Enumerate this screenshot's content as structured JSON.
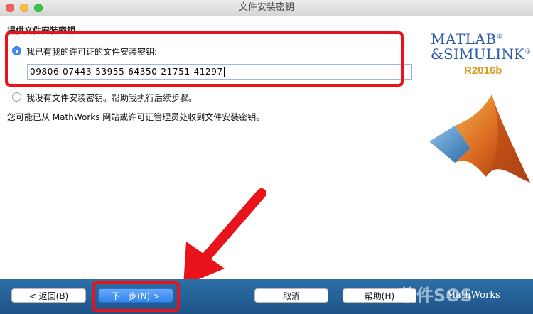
{
  "window": {
    "title": "文件安装密钥"
  },
  "section": {
    "title": "提供文件安装密钥"
  },
  "options": {
    "has_key_label": "我已有我的许可证的文件安装密钥:",
    "no_key_label": "我没有文件安装密钥。帮助我执行后续步骤。"
  },
  "key_field": {
    "value": "09806-07443-53955-64350-21751-41297"
  },
  "note": "您可能已从 MathWorks 网站或许可证管理员处收到文件安装密钥。",
  "logo": {
    "line1": "MATLAB",
    "line2": "&SIMULINK",
    "release": "R2016b",
    "trademark": "®"
  },
  "buttons": {
    "back": "< 返回(B)",
    "next": "下一步(N) >",
    "cancel": "取消",
    "help": "帮助(H)"
  },
  "brand": {
    "mathworks": "MathWorks"
  },
  "watermark": "软件SOS",
  "colors": {
    "highlight": "#e8131b",
    "accent": "#3b8ff3",
    "bar": "#1d5488"
  }
}
